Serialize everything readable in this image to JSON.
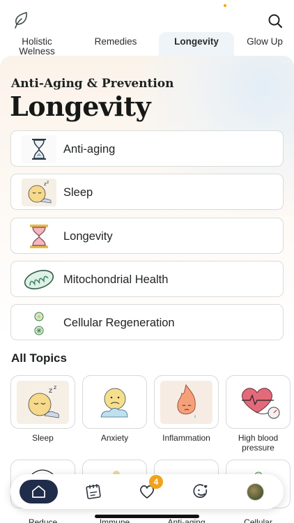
{
  "header": {
    "logo_icon": "leaf-icon",
    "search_icon": "search-icon"
  },
  "tabs": [
    {
      "label": "Holistic\nWelness",
      "active": false
    },
    {
      "label": "Remedies",
      "active": false
    },
    {
      "label": "Longevity",
      "active": true
    },
    {
      "label": "Glow Up",
      "active": false
    }
  ],
  "hero": {
    "kicker": "Anti-Aging & Prevention",
    "title": "Longevity"
  },
  "categories": [
    {
      "label": "Anti-aging",
      "icon": "hourglass-icon"
    },
    {
      "label": "Sleep",
      "icon": "sleeping-face-icon"
    },
    {
      "label": "Longevity",
      "icon": "hourglass-pink-icon"
    },
    {
      "label": "Mitochondrial Health",
      "icon": "mitochondria-icon"
    },
    {
      "label": "Cellular Regeneration",
      "icon": "cell-icon"
    }
  ],
  "all_topics": {
    "title": "All Topics",
    "row1": [
      {
        "label": "Sleep",
        "icon": "sleeping-face-icon"
      },
      {
        "label": "Anxiety",
        "icon": "worried-face-icon"
      },
      {
        "label": "Inflammation",
        "icon": "flame-face-icon"
      },
      {
        "label": "High blood pressure",
        "icon": "heart-gauge-icon"
      }
    ],
    "row2": [
      {
        "label": "Reduce",
        "icon": "body-outline-icon"
      },
      {
        "label": "Immune",
        "icon": "immune-icon"
      },
      {
        "label": "Anti-aging",
        "icon": "hourglass-icon"
      },
      {
        "label": "Cellular",
        "icon": "cell-icon"
      }
    ]
  },
  "nav": {
    "home_icon": "home-icon",
    "journal_icon": "notebook-icon",
    "favorites_icon": "heart-icon",
    "favorites_badge": "4",
    "mood_icon": "smile-heart-icon",
    "profile_icon": "avatar"
  },
  "colors": {
    "accent_navy": "#1f2c4a",
    "badge_orange": "#f2a21a",
    "card_border": "#d9dcda"
  }
}
